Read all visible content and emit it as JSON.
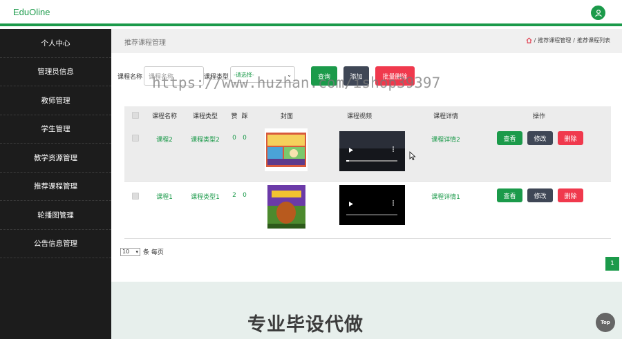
{
  "app": {
    "brand": "EduOline"
  },
  "sidebar": {
    "items": [
      {
        "label": "个人中心"
      },
      {
        "label": "管理员信息"
      },
      {
        "label": "教师管理"
      },
      {
        "label": "学生管理"
      },
      {
        "label": "教学资源管理"
      },
      {
        "label": "推荐课程管理"
      },
      {
        "label": "轮播图管理"
      },
      {
        "label": "公告信息管理"
      }
    ]
  },
  "header": {
    "title": "推荐课程管理",
    "breadcrumb": [
      "推荐课程管理",
      "推荐课程列表"
    ]
  },
  "search": {
    "name_label": "课程名称",
    "name_placeholder": "课程名称",
    "type_label": "课程类型",
    "type_value": "-请选择-",
    "query_btn": "查询",
    "add_btn": "添加",
    "batch_delete_btn": "批量删除"
  },
  "table": {
    "columns": [
      "课程名称",
      "课程类型",
      "赞",
      "踩",
      "封面",
      "课程视频",
      "课程详情",
      "操作"
    ],
    "rows": [
      {
        "name": "课程2",
        "type": "课程类型2",
        "likes": "0",
        "dislikes": "0",
        "detail": "课程详情2"
      },
      {
        "name": "课程1",
        "type": "课程类型1",
        "likes": "2",
        "dislikes": "0",
        "detail": "课程详情1"
      }
    ],
    "actions": {
      "view": "查看",
      "edit": "修改",
      "delete": "删除"
    }
  },
  "pager": {
    "page_size": "10",
    "per_page_label": "条 每页",
    "current_page": "1"
  },
  "overlay": {
    "promo": "专业毕设代做",
    "url": "https://www.huzhan.com/ishop39397",
    "top_btn": "Top"
  },
  "colors": {
    "brand_green": "#1b9a4a",
    "dark": "#1c1c1c",
    "danger": "#f0394d",
    "slate": "#3f4756"
  }
}
